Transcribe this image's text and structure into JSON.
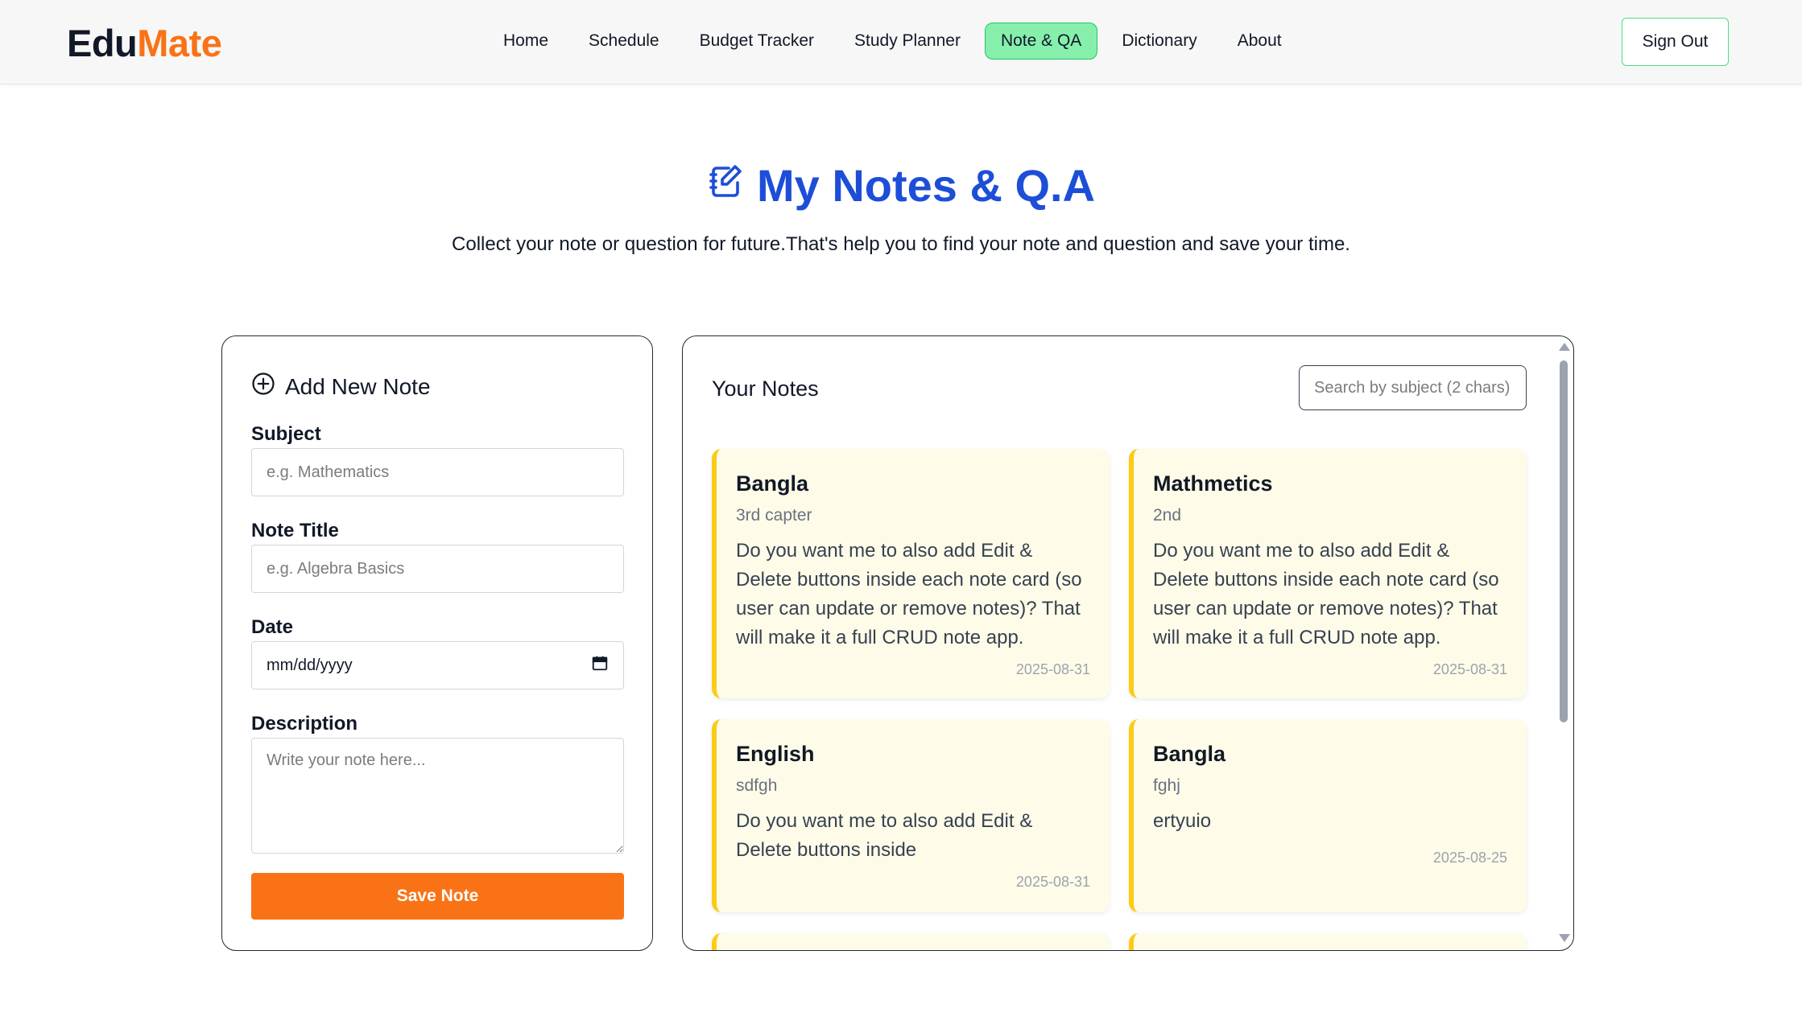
{
  "brand": {
    "part1": "Edu",
    "part2": "Mate"
  },
  "nav": {
    "items": [
      {
        "label": "Home"
      },
      {
        "label": "Schedule"
      },
      {
        "label": "Budget Tracker"
      },
      {
        "label": "Study Planner"
      },
      {
        "label": "Note & QA"
      },
      {
        "label": "Dictionary"
      },
      {
        "label": "About"
      }
    ],
    "active": "Note & QA",
    "signout_label": "Sign Out"
  },
  "header": {
    "title": "My Notes & Q.A",
    "title_icon": "note-edit-icon",
    "subtitle": "Collect your note or question for future.That's help you to find your note and question and save your time."
  },
  "form": {
    "heading": "Add New Note",
    "heading_icon": "plus-circle-icon",
    "subject_label": "Subject",
    "subject_placeholder": "e.g. Mathematics",
    "title_label": "Note Title",
    "title_placeholder": "e.g. Algebra Basics",
    "date_label": "Date",
    "date_placeholder": "mm/dd/yyyy",
    "date_icon": "calendar-icon",
    "description_label": "Description",
    "description_placeholder": "Write your note here...",
    "save_label": "Save Note"
  },
  "notes": {
    "heading": "Your Notes",
    "search_placeholder": "Search by subject (2 chars)",
    "items": [
      {
        "subject": "Bangla",
        "title": "3rd capter",
        "description": "Do you want me to also add Edit & Delete buttons inside each note card (so user can update or remove notes)? That will make it a full CRUD note app.",
        "date": "2025-08-31"
      },
      {
        "subject": "Mathmetics",
        "title": "2nd",
        "description": "Do you want me to also add Edit & Delete buttons inside each note card (so user can update or remove notes)? That will make it a full CRUD note app.",
        "date": "2025-08-31"
      },
      {
        "subject": "English",
        "title": "sdfgh",
        "description": "Do you want me to also add Edit & Delete buttons inside",
        "date": "2025-08-31"
      },
      {
        "subject": "Bangla",
        "title": "fghj",
        "description": "ertyuio",
        "date": "2025-08-25"
      }
    ]
  },
  "colors": {
    "brand_orange": "#f97316",
    "title_blue": "#1d4ed8",
    "active_nav_green": "#86efac",
    "card_bg": "#fefce8",
    "card_border": "#facc15"
  }
}
